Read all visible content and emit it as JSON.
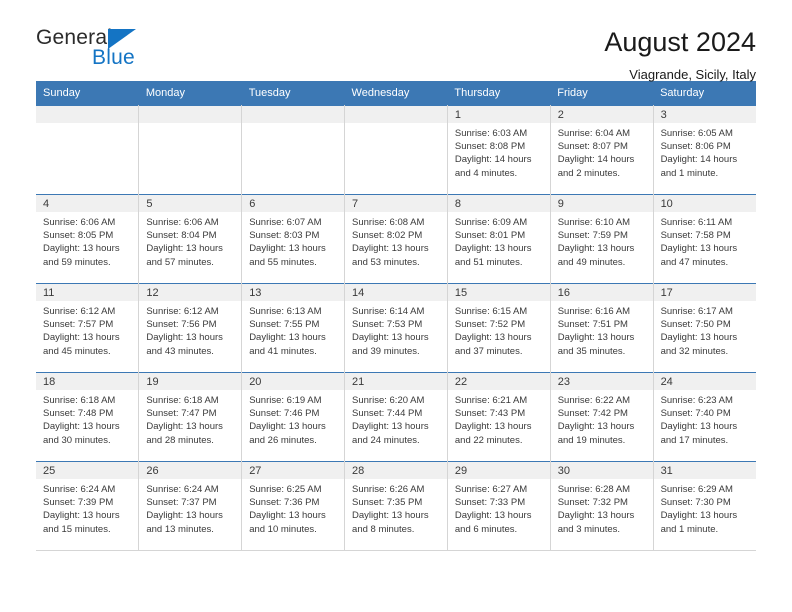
{
  "brand": {
    "name_top": "General",
    "name_bottom": "Blue",
    "accent_color": "#1474c4"
  },
  "header": {
    "title": "August 2024",
    "location": "Viagrande, Sicily, Italy"
  },
  "theme": {
    "header_row_bg": "#3c78b4",
    "daynum_bg": "#f0f0f0",
    "text_color": "#3a3a3a",
    "grid_line": "#d5d5d5"
  },
  "weekdays": [
    "Sunday",
    "Monday",
    "Tuesday",
    "Wednesday",
    "Thursday",
    "Friday",
    "Saturday"
  ],
  "labels": {
    "sunrise_prefix": "Sunrise: ",
    "sunset_prefix": "Sunset: ",
    "daylight_prefix": "Daylight: "
  },
  "weeks": [
    [
      {
        "empty": true
      },
      {
        "empty": true
      },
      {
        "empty": true
      },
      {
        "empty": true
      },
      {
        "day": "1",
        "sunrise": "Sunrise: 6:03 AM",
        "sunset": "Sunset: 8:08 PM",
        "daylight_1": "Daylight: 14 hours",
        "daylight_2": "and 4 minutes."
      },
      {
        "day": "2",
        "sunrise": "Sunrise: 6:04 AM",
        "sunset": "Sunset: 8:07 PM",
        "daylight_1": "Daylight: 14 hours",
        "daylight_2": "and 2 minutes."
      },
      {
        "day": "3",
        "sunrise": "Sunrise: 6:05 AM",
        "sunset": "Sunset: 8:06 PM",
        "daylight_1": "Daylight: 14 hours",
        "daylight_2": "and 1 minute."
      }
    ],
    [
      {
        "day": "4",
        "sunrise": "Sunrise: 6:06 AM",
        "sunset": "Sunset: 8:05 PM",
        "daylight_1": "Daylight: 13 hours",
        "daylight_2": "and 59 minutes."
      },
      {
        "day": "5",
        "sunrise": "Sunrise: 6:06 AM",
        "sunset": "Sunset: 8:04 PM",
        "daylight_1": "Daylight: 13 hours",
        "daylight_2": "and 57 minutes."
      },
      {
        "day": "6",
        "sunrise": "Sunrise: 6:07 AM",
        "sunset": "Sunset: 8:03 PM",
        "daylight_1": "Daylight: 13 hours",
        "daylight_2": "and 55 minutes."
      },
      {
        "day": "7",
        "sunrise": "Sunrise: 6:08 AM",
        "sunset": "Sunset: 8:02 PM",
        "daylight_1": "Daylight: 13 hours",
        "daylight_2": "and 53 minutes."
      },
      {
        "day": "8",
        "sunrise": "Sunrise: 6:09 AM",
        "sunset": "Sunset: 8:01 PM",
        "daylight_1": "Daylight: 13 hours",
        "daylight_2": "and 51 minutes."
      },
      {
        "day": "9",
        "sunrise": "Sunrise: 6:10 AM",
        "sunset": "Sunset: 7:59 PM",
        "daylight_1": "Daylight: 13 hours",
        "daylight_2": "and 49 minutes."
      },
      {
        "day": "10",
        "sunrise": "Sunrise: 6:11 AM",
        "sunset": "Sunset: 7:58 PM",
        "daylight_1": "Daylight: 13 hours",
        "daylight_2": "and 47 minutes."
      }
    ],
    [
      {
        "day": "11",
        "sunrise": "Sunrise: 6:12 AM",
        "sunset": "Sunset: 7:57 PM",
        "daylight_1": "Daylight: 13 hours",
        "daylight_2": "and 45 minutes."
      },
      {
        "day": "12",
        "sunrise": "Sunrise: 6:12 AM",
        "sunset": "Sunset: 7:56 PM",
        "daylight_1": "Daylight: 13 hours",
        "daylight_2": "and 43 minutes."
      },
      {
        "day": "13",
        "sunrise": "Sunrise: 6:13 AM",
        "sunset": "Sunset: 7:55 PM",
        "daylight_1": "Daylight: 13 hours",
        "daylight_2": "and 41 minutes."
      },
      {
        "day": "14",
        "sunrise": "Sunrise: 6:14 AM",
        "sunset": "Sunset: 7:53 PM",
        "daylight_1": "Daylight: 13 hours",
        "daylight_2": "and 39 minutes."
      },
      {
        "day": "15",
        "sunrise": "Sunrise: 6:15 AM",
        "sunset": "Sunset: 7:52 PM",
        "daylight_1": "Daylight: 13 hours",
        "daylight_2": "and 37 minutes."
      },
      {
        "day": "16",
        "sunrise": "Sunrise: 6:16 AM",
        "sunset": "Sunset: 7:51 PM",
        "daylight_1": "Daylight: 13 hours",
        "daylight_2": "and 35 minutes."
      },
      {
        "day": "17",
        "sunrise": "Sunrise: 6:17 AM",
        "sunset": "Sunset: 7:50 PM",
        "daylight_1": "Daylight: 13 hours",
        "daylight_2": "and 32 minutes."
      }
    ],
    [
      {
        "day": "18",
        "sunrise": "Sunrise: 6:18 AM",
        "sunset": "Sunset: 7:48 PM",
        "daylight_1": "Daylight: 13 hours",
        "daylight_2": "and 30 minutes."
      },
      {
        "day": "19",
        "sunrise": "Sunrise: 6:18 AM",
        "sunset": "Sunset: 7:47 PM",
        "daylight_1": "Daylight: 13 hours",
        "daylight_2": "and 28 minutes."
      },
      {
        "day": "20",
        "sunrise": "Sunrise: 6:19 AM",
        "sunset": "Sunset: 7:46 PM",
        "daylight_1": "Daylight: 13 hours",
        "daylight_2": "and 26 minutes."
      },
      {
        "day": "21",
        "sunrise": "Sunrise: 6:20 AM",
        "sunset": "Sunset: 7:44 PM",
        "daylight_1": "Daylight: 13 hours",
        "daylight_2": "and 24 minutes."
      },
      {
        "day": "22",
        "sunrise": "Sunrise: 6:21 AM",
        "sunset": "Sunset: 7:43 PM",
        "daylight_1": "Daylight: 13 hours",
        "daylight_2": "and 22 minutes."
      },
      {
        "day": "23",
        "sunrise": "Sunrise: 6:22 AM",
        "sunset": "Sunset: 7:42 PM",
        "daylight_1": "Daylight: 13 hours",
        "daylight_2": "and 19 minutes."
      },
      {
        "day": "24",
        "sunrise": "Sunrise: 6:23 AM",
        "sunset": "Sunset: 7:40 PM",
        "daylight_1": "Daylight: 13 hours",
        "daylight_2": "and 17 minutes."
      }
    ],
    [
      {
        "day": "25",
        "sunrise": "Sunrise: 6:24 AM",
        "sunset": "Sunset: 7:39 PM",
        "daylight_1": "Daylight: 13 hours",
        "daylight_2": "and 15 minutes."
      },
      {
        "day": "26",
        "sunrise": "Sunrise: 6:24 AM",
        "sunset": "Sunset: 7:37 PM",
        "daylight_1": "Daylight: 13 hours",
        "daylight_2": "and 13 minutes."
      },
      {
        "day": "27",
        "sunrise": "Sunrise: 6:25 AM",
        "sunset": "Sunset: 7:36 PM",
        "daylight_1": "Daylight: 13 hours",
        "daylight_2": "and 10 minutes."
      },
      {
        "day": "28",
        "sunrise": "Sunrise: 6:26 AM",
        "sunset": "Sunset: 7:35 PM",
        "daylight_1": "Daylight: 13 hours",
        "daylight_2": "and 8 minutes."
      },
      {
        "day": "29",
        "sunrise": "Sunrise: 6:27 AM",
        "sunset": "Sunset: 7:33 PM",
        "daylight_1": "Daylight: 13 hours",
        "daylight_2": "and 6 minutes."
      },
      {
        "day": "30",
        "sunrise": "Sunrise: 6:28 AM",
        "sunset": "Sunset: 7:32 PM",
        "daylight_1": "Daylight: 13 hours",
        "daylight_2": "and 3 minutes."
      },
      {
        "day": "31",
        "sunrise": "Sunrise: 6:29 AM",
        "sunset": "Sunset: 7:30 PM",
        "daylight_1": "Daylight: 13 hours",
        "daylight_2": "and 1 minute."
      }
    ]
  ]
}
